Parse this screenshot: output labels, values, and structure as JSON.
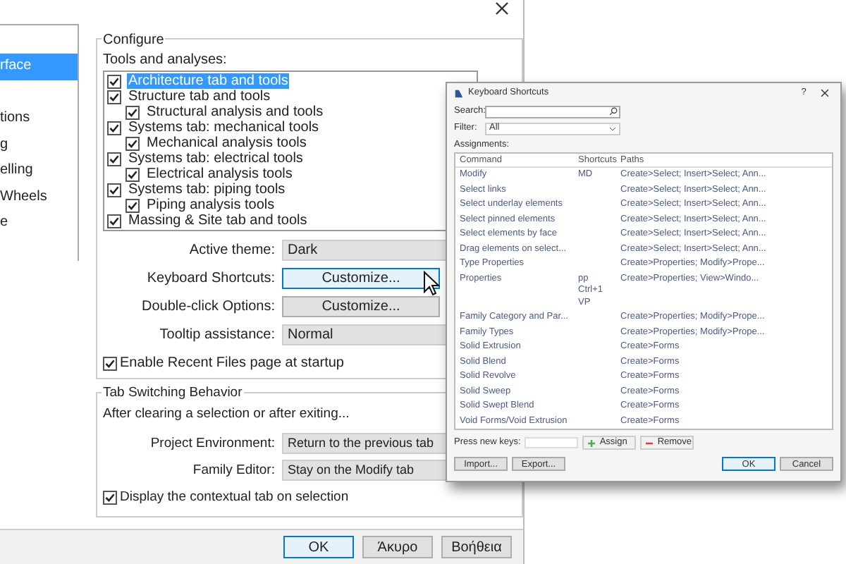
{
  "sidebar": {
    "items": [
      {
        "label": "rface",
        "selected": true
      },
      {
        "label": "tions",
        "selected": false
      },
      {
        "label": "g",
        "selected": false
      },
      {
        "label": "elling",
        "selected": false
      },
      {
        "label": "Wheels",
        "selected": false
      },
      {
        "label": "e",
        "selected": false
      }
    ]
  },
  "configure": {
    "title": "Configure",
    "tools_label": "Tools and analyses:",
    "tools": [
      {
        "label": "Architecture tab and tools",
        "checked": true,
        "selected": true
      },
      {
        "label": "Structure tab and tools",
        "checked": true,
        "selected": false,
        "children": [
          {
            "label": "Structural analysis and tools",
            "checked": true,
            "selected": false
          }
        ]
      },
      {
        "label": "Systems tab: mechanical tools",
        "checked": true,
        "selected": false,
        "children": [
          {
            "label": "Mechanical analysis tools",
            "checked": true,
            "selected": false
          }
        ]
      },
      {
        "label": "Systems tab: electrical tools",
        "checked": true,
        "selected": false,
        "children": [
          {
            "label": "Electrical analysis tools",
            "checked": true,
            "selected": false
          }
        ]
      },
      {
        "label": "Systems tab: piping tools",
        "checked": true,
        "selected": false,
        "children": [
          {
            "label": "Piping analysis tools",
            "checked": true,
            "selected": false
          }
        ]
      },
      {
        "label": "Massing & Site tab and tools",
        "checked": true,
        "selected": false
      }
    ],
    "fields": [
      {
        "kind": "dropdown",
        "label": "Active theme:",
        "value": "Dark"
      },
      {
        "kind": "button",
        "label": "Keyboard Shortcuts:",
        "value": "Customize...",
        "selected": true
      },
      {
        "kind": "button",
        "label": "Double-click Options:",
        "value": "Customize...",
        "selected": false
      },
      {
        "kind": "dropdown",
        "label": "Tooltip assistance:",
        "value": "Normal"
      }
    ],
    "recent_files": {
      "label": "Enable Recent Files page at startup",
      "checked": true
    }
  },
  "tab_switching": {
    "title": "Tab Switching Behavior",
    "intro": "After clearing a selection or after exiting...",
    "fields": [
      {
        "label": "Project Environment:",
        "value": "Return to the previous tab"
      },
      {
        "label": "Family Editor:",
        "value": "Stay on the Modify tab"
      }
    ],
    "contextual": {
      "label": "Display the contextual tab on selection",
      "checked": true
    }
  },
  "buttons": [
    {
      "label": "OK",
      "selected": true
    },
    {
      "label": "Άκυρο",
      "selected": false
    },
    {
      "label": "Βοήθεια",
      "selected": false
    }
  ],
  "shortcuts_dialog": {
    "title": "Keyboard Shortcuts",
    "help": "?",
    "search_label": "Search:",
    "filter_label": "Filter:",
    "filter_value": "All",
    "assignments_label": "Assignments:",
    "columns": [
      "Command",
      "Shortcuts",
      "Paths"
    ],
    "rows": [
      {
        "command": "Modify",
        "shortcuts": [
          "MD"
        ],
        "paths": "Create>Select; Insert>Select; Ann..."
      },
      {
        "command": "Select links",
        "shortcuts": [],
        "paths": "Create>Select; Insert>Select; Ann..."
      },
      {
        "command": "Select underlay elements",
        "shortcuts": [],
        "paths": "Create>Select; Insert>Select; Ann..."
      },
      {
        "command": "Select pinned elements",
        "shortcuts": [],
        "paths": "Create>Select; Insert>Select; Ann..."
      },
      {
        "command": "Select elements by face",
        "shortcuts": [],
        "paths": "Create>Select; Insert>Select; Ann..."
      },
      {
        "command": "Drag elements on select...",
        "shortcuts": [],
        "paths": "Create>Select; Insert>Select; Ann..."
      },
      {
        "command": "Type Properties",
        "shortcuts": [],
        "paths": "Create>Properties; Modify>Prope..."
      },
      {
        "command": "Properties",
        "shortcuts": [
          "pp",
          "Ctrl+1",
          "VP"
        ],
        "paths": "Create>Properties; View>Windo..."
      },
      {
        "command": "Family Category and Par...",
        "shortcuts": [],
        "paths": "Create>Properties; Modify>Prope..."
      },
      {
        "command": "Family Types",
        "shortcuts": [],
        "paths": "Create>Properties; Modify>Prope..."
      },
      {
        "command": "Solid Extrusion",
        "shortcuts": [],
        "paths": "Create>Forms"
      },
      {
        "command": "Solid Blend",
        "shortcuts": [],
        "paths": "Create>Forms"
      },
      {
        "command": "Solid Revolve",
        "shortcuts": [],
        "paths": "Create>Forms"
      },
      {
        "command": "Solid Sweep",
        "shortcuts": [],
        "paths": "Create>Forms"
      },
      {
        "command": "Solid Swept Blend",
        "shortcuts": [],
        "paths": "Create>Forms"
      },
      {
        "command": "Void Forms/Void Extrusion",
        "shortcuts": [],
        "paths": "Create>Forms"
      }
    ],
    "press_keys_label": "Press new keys:",
    "assign": "Assign",
    "remove": "Remove",
    "import": "Import...",
    "export": "Export...",
    "ok": "OK",
    "cancel": "Cancel"
  }
}
